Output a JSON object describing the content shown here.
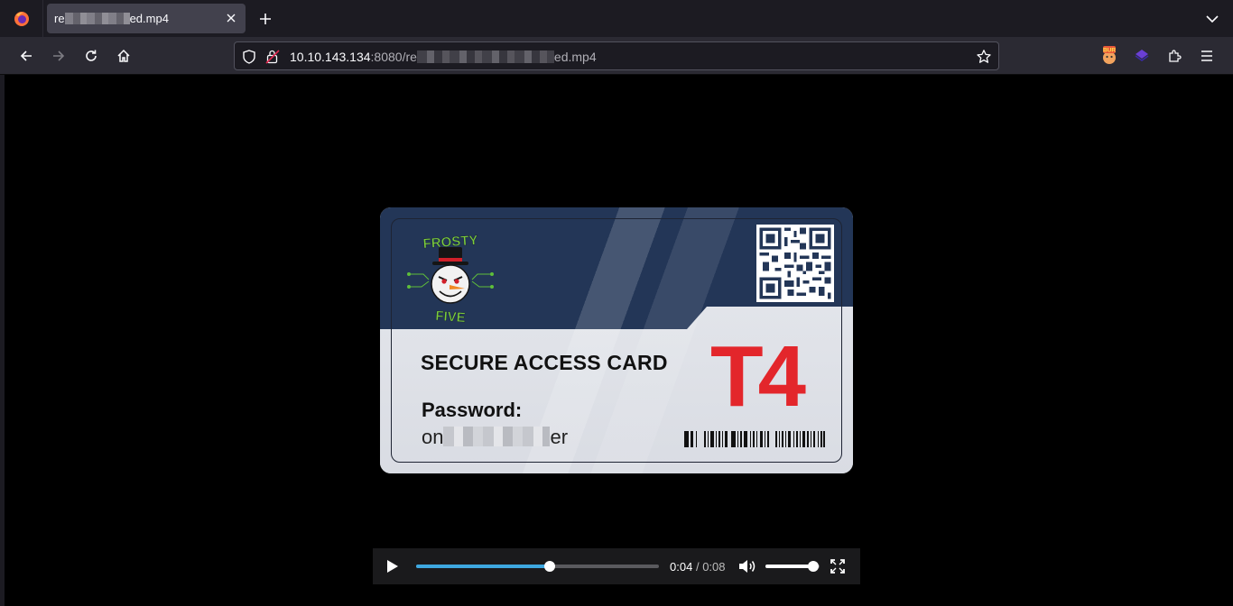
{
  "browser": {
    "tab": {
      "title_prefix": "re",
      "title_suffix": "ed.mp4",
      "icon": "firefox-icon"
    },
    "toolbar": {
      "back_icon": "back-arrow-icon",
      "forward_icon": "forward-arrow-icon",
      "reload_icon": "reload-icon",
      "home_icon": "home-icon"
    },
    "url": {
      "host": "10.10.143.134",
      "rest_prefix": ":8080/re",
      "rest_suffix": "ed.mp4"
    },
    "extensions": [
      "burp-extension-icon",
      "purple-cube-extension-icon",
      "extensions-puzzle-icon",
      "hamburger-menu-icon"
    ]
  },
  "card": {
    "logo_top": "FROSTY",
    "logo_bottom": "FIVE",
    "heading": "SECURE ACCESS CARD",
    "password_label": "Password:",
    "password_prefix": "on",
    "password_suffix": "er",
    "tier": "T4",
    "colors": {
      "navy": "#233657",
      "red": "#e3262b",
      "green": "#7ccd3a"
    }
  },
  "player": {
    "current_time": "0:04",
    "separator": "/",
    "duration": "0:08",
    "progress_fraction": 0.55,
    "volume_fraction": 0.88,
    "accent": "#3ea8e0"
  }
}
